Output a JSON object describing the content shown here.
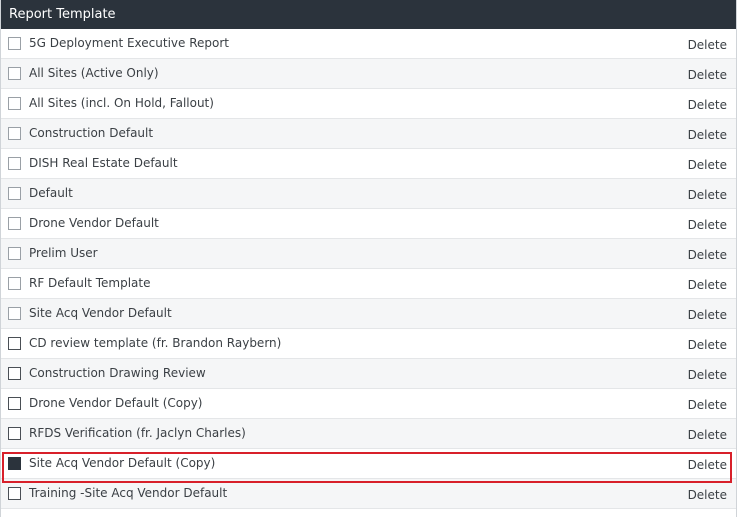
{
  "panel": {
    "title": "Report Template",
    "delete_label": "Delete"
  },
  "rows": [
    {
      "label": "5G Deployment Executive Report",
      "checked": false
    },
    {
      "label": "All Sites (Active Only)",
      "checked": false
    },
    {
      "label": "All Sites (incl. On Hold, Fallout)",
      "checked": false
    },
    {
      "label": "Construction Default",
      "checked": false
    },
    {
      "label": "DISH Real Estate Default",
      "checked": false
    },
    {
      "label": "Default",
      "checked": false
    },
    {
      "label": "Drone Vendor Default",
      "checked": false
    },
    {
      "label": "Prelim User",
      "checked": false
    },
    {
      "label": "RF Default Template",
      "checked": false
    },
    {
      "label": "Site Acq Vendor Default",
      "checked": false
    },
    {
      "label": "CD review template (fr. Brandon Raybern)",
      "checked": false
    },
    {
      "label": "Construction Drawing Review",
      "checked": false
    },
    {
      "label": "Drone Vendor Default (Copy)",
      "checked": false
    },
    {
      "label": "RFDS Verification (fr. Jaclyn Charles)",
      "checked": false
    },
    {
      "label": "Site Acq Vendor Default (Copy)",
      "checked": true
    },
    {
      "label": "Training -Site Acq Vendor Default",
      "checked": false
    }
  ],
  "colors": {
    "header_bg": "#2b333c",
    "highlight": "#d8202a",
    "checked_fill": "#2b333c"
  }
}
